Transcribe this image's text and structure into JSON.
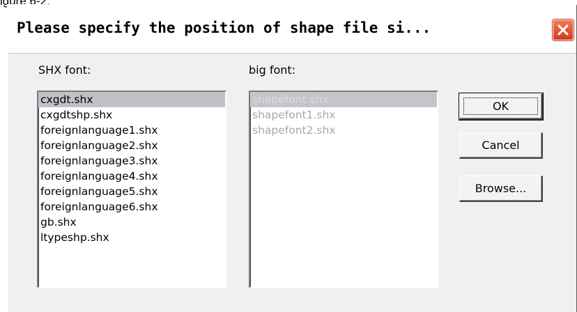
{
  "caption": "igure 6-2.",
  "dialog": {
    "title": "Please specify the position of shape file si...",
    "close_icon": "close-x-icon"
  },
  "shx": {
    "label": "SHX font:",
    "items": [
      "cxgdt.shx",
      "cxgdtshp.shx",
      "foreignlanguage1.shx",
      "foreignlanguage2.shx",
      "foreignlanguage3.shx",
      "foreignlanguage4.shx",
      "foreignlanguage5.shx",
      "foreignlanguage6.shx",
      "gb.shx",
      "ltypeshp.shx"
    ],
    "selected": "cxgdt.shx"
  },
  "big": {
    "label": "big font:",
    "items": [
      "shapefont.shx",
      "shapefont1.shx",
      "shapefont2.shx"
    ],
    "selected": "shapefont.shx"
  },
  "buttons": {
    "ok": "OK",
    "cancel": "Cancel",
    "browse": "Browse..."
  },
  "colors": {
    "close_button": "#e05a3a",
    "selection": "#c0c0c8",
    "dialog_bg": "#f0f0f0"
  }
}
